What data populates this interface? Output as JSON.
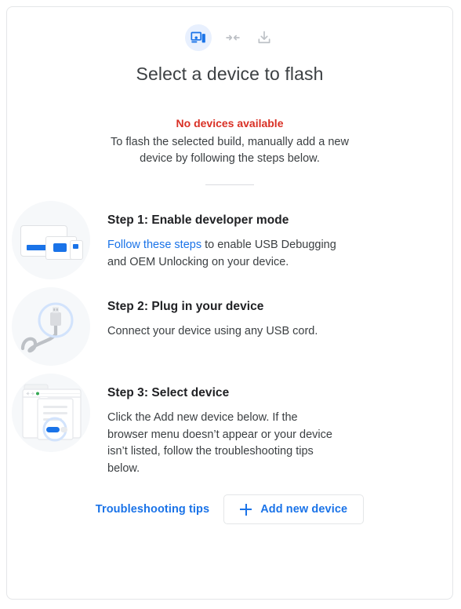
{
  "card": {
    "title": "Select a device to flash",
    "header_icons": [
      {
        "name": "devices-icon",
        "state": "active"
      },
      {
        "name": "connect-arrows-icon",
        "state": "inactive"
      },
      {
        "name": "download-icon",
        "state": "inactive"
      }
    ],
    "status": {
      "error": "No devices available",
      "description": "To flash the selected build, manually add a new device by following the steps below."
    },
    "steps": [
      {
        "illustration": "devices-illustration",
        "title": "Step 1: Enable developer mode",
        "link_text": "Follow these steps",
        "text_after_link": " to enable USB Debugging and OEM Unlocking on your device.",
        "text": ""
      },
      {
        "illustration": "usb-cable-illustration",
        "title": "Step 2: Plug in your device",
        "link_text": "",
        "text_after_link": "",
        "text": "Connect your device using any USB cord."
      },
      {
        "illustration": "browser-dialog-illustration",
        "title": "Step 3: Select device",
        "link_text": "",
        "text_after_link": "",
        "text": "Click the Add new device below. If the browser menu doesn’t appear or your device isn’t listed, follow the troubleshooting tips below."
      }
    ],
    "footer": {
      "troubleshooting_label": "Troubleshooting tips",
      "add_device_label": "Add new device",
      "add_device_icon": "plus-icon"
    },
    "colors": {
      "accent_blue": "#1a73e8",
      "error_red": "#d93025",
      "icon_bg_blue": "#e8f0fe",
      "illustration_bg": "#f6f8fa",
      "border_gray": "#e4e6e8",
      "text_primary": "#202124",
      "text_secondary": "#3c4043"
    }
  }
}
